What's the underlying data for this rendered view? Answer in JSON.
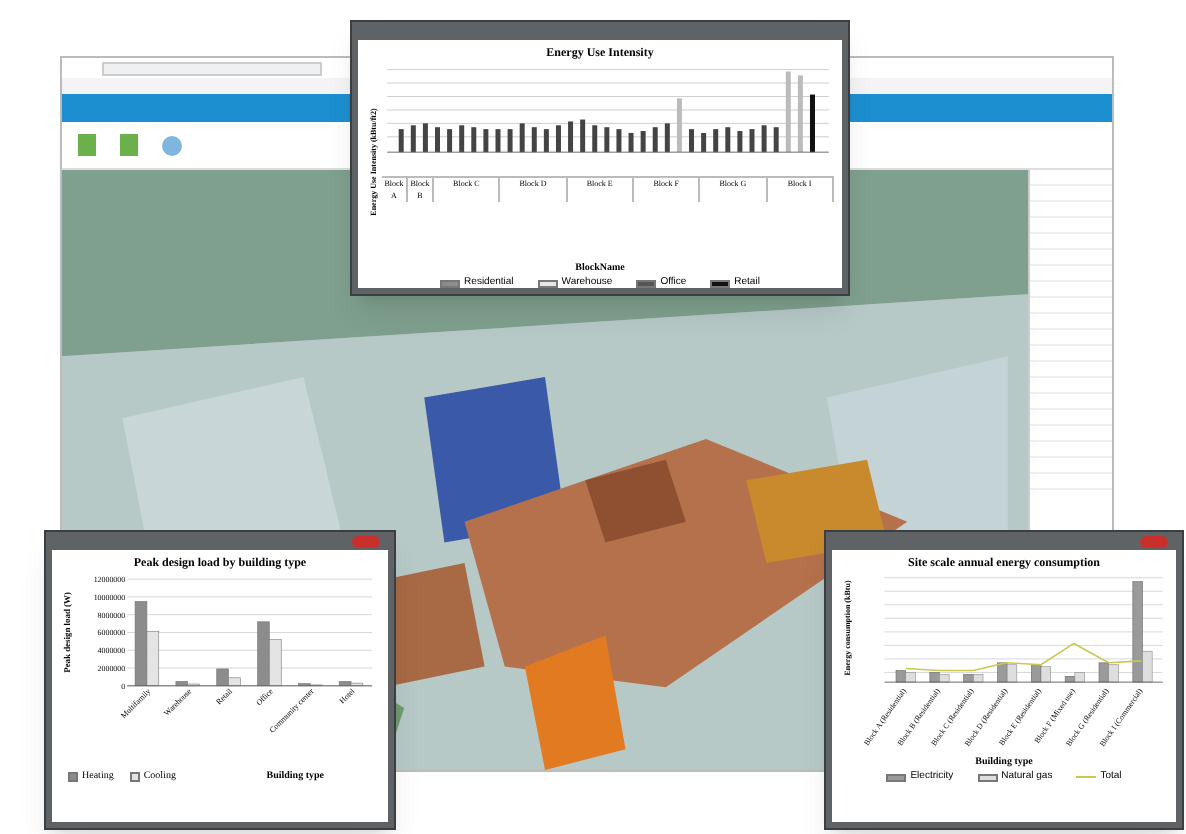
{
  "energy_use_window": {
    "title": "Energy Use Intensity",
    "ylabel": "Energy Use Intensity (kBtu/ft2)",
    "xlabel": "BlockName",
    "groups": [
      "Block A",
      "Block B",
      "Block C",
      "Block D",
      "Block E",
      "Block F",
      "Block G",
      "Block I"
    ],
    "legend": [
      {
        "label": "Residential",
        "color": "#8c8c8c"
      },
      {
        "label": "Warehouse",
        "color": "#e6e6e6"
      },
      {
        "label": "Office",
        "color": "#555555"
      },
      {
        "label": "Retail",
        "color": "#111111"
      }
    ]
  },
  "peak_load_window": {
    "chart_data": {
      "type": "bar",
      "title": "Peak design load by building type",
      "xlabel": "Building type",
      "ylabel": "Peak design load (W)",
      "categories": [
        "Multifamily",
        "Warehouse",
        "Retail",
        "Office",
        "Community center",
        "Hotel"
      ],
      "series": [
        {
          "name": "Heating",
          "color": "#8c8c8c",
          "values": [
            9500000,
            500000,
            1900000,
            7200000,
            250000,
            500000
          ]
        },
        {
          "name": "Cooling",
          "color": "#e4e4e4",
          "values": [
            6100000,
            200000,
            900000,
            5200000,
            100000,
            300000
          ]
        }
      ],
      "ylim": [
        0,
        12000000
      ],
      "grid": true,
      "yticks": [
        0,
        2000000,
        4000000,
        6000000,
        8000000,
        10000000,
        12000000
      ]
    }
  },
  "site_energy_window": {
    "title": "Site scale annual energy consumption",
    "ylabel": "Energy consumption (kBtu)",
    "xlabel": "Building type",
    "categories": [
      "Block A (Residential)",
      "Block B (Residential)",
      "Block C (Residential)",
      "Block D (Residential)",
      "Block E (Residential)",
      "Block F (Mixed use)",
      "Block G (Residential)",
      "Block I (Commercial)"
    ],
    "legend": [
      {
        "label": "Electricity",
        "color": "#9a9a9a",
        "kind": "bar"
      },
      {
        "label": "Natural gas",
        "color": "#dedede",
        "kind": "bar"
      },
      {
        "label": "Total",
        "color": "#c8c850",
        "kind": "line"
      }
    ]
  }
}
